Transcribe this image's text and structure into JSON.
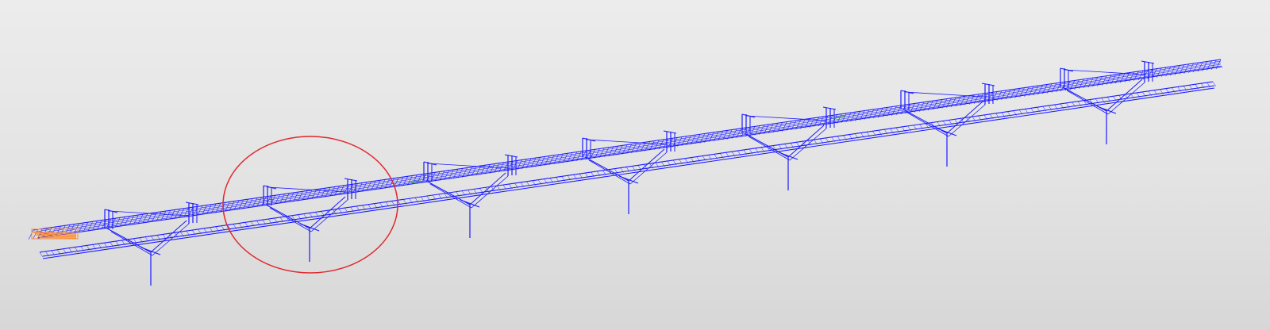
{
  "viewport": {
    "background_top": "#ececec",
    "background_bottom": "#d7d7d7"
  },
  "model": {
    "wire_color": "#1a1aff",
    "accent_green": "#1fa34a",
    "end_highlight_color": "#ff8a2b",
    "markup_circle_color": "#e0282d",
    "support_count": 7,
    "markup_target_support": 2
  }
}
